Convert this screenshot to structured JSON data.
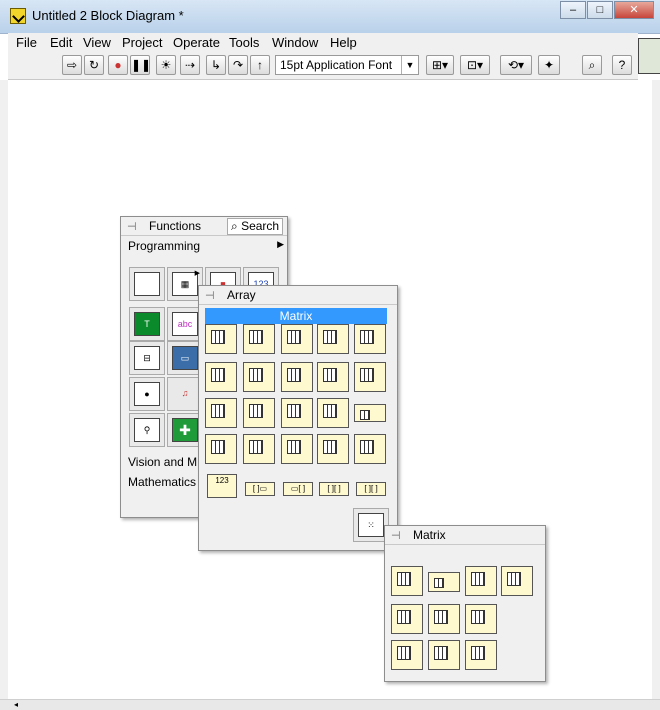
{
  "window": {
    "title": "Untitled 2 Block Diagram *",
    "min": "–",
    "max": "□",
    "close": "✕"
  },
  "menu": [
    "File",
    "Edit",
    "View",
    "Project",
    "Operate",
    "Tools",
    "Window",
    "Help"
  ],
  "toolbar": {
    "font": "15pt Application Font"
  },
  "functions_palette": {
    "title": "Functions",
    "search": "Search",
    "category": "Programming",
    "row_vision": "Vision and M",
    "row_math": "Mathematics",
    "number_icon": "123",
    "string_icon": "abc"
  },
  "array_palette": {
    "title": "Array",
    "selected": "Matrix",
    "index_icon": "123"
  },
  "matrix_palette": {
    "title": "Matrix"
  }
}
